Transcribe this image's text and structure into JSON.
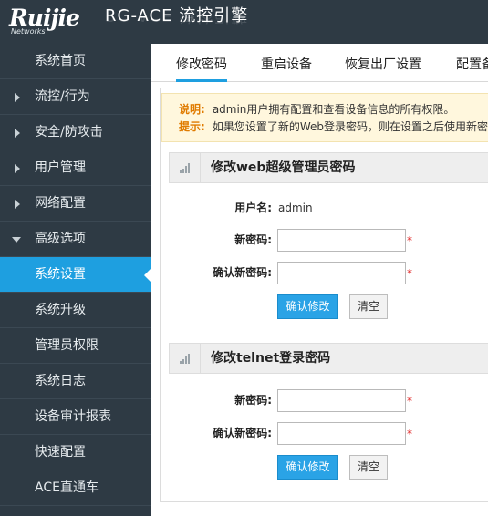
{
  "header": {
    "logo_text": "Ruijie",
    "logo_sub": "Networks",
    "app_title": "RG-ACE 流控引擎"
  },
  "sidebar": {
    "items": [
      {
        "label": "系统首页"
      },
      {
        "label": "流控/行为"
      },
      {
        "label": "安全/防攻击"
      },
      {
        "label": "用户管理"
      },
      {
        "label": "网络配置"
      },
      {
        "label": "高级选项"
      },
      {
        "label": "系统设置"
      },
      {
        "label": "系统升级"
      },
      {
        "label": "管理员权限"
      },
      {
        "label": "系统日志"
      },
      {
        "label": "设备审计报表"
      },
      {
        "label": "快速配置"
      },
      {
        "label": "ACE直通车"
      }
    ]
  },
  "tabs": [
    {
      "label": "修改密码"
    },
    {
      "label": "重启设备"
    },
    {
      "label": "恢复出厂设置"
    },
    {
      "label": "配置备份"
    }
  ],
  "notice": {
    "desc_key": "说明:",
    "desc_text": "admin用户拥有配置和查看设备信息的所有权限。",
    "tip_key": "提示:",
    "tip_text": "如果您设置了新的Web登录密码，则在设置之后使用新密码重新登录"
  },
  "web_section": {
    "title": "修改web超级管理员密码",
    "username_label": "用户名:",
    "username_value": "admin",
    "new_password_label": "新密码:",
    "confirm_password_label": "确认新密码:",
    "confirm_button": "确认修改",
    "clear_button": "清空"
  },
  "telnet_section": {
    "title": "修改telnet登录密码",
    "new_password_label": "新密码:",
    "confirm_password_label": "确认新密码:",
    "confirm_button": "确认修改",
    "clear_button": "清空"
  },
  "required_mark": "*",
  "colors": {
    "sidebar_bg": "#2e3a44",
    "accent": "#1e9fe0",
    "notice_bg": "#fff7dd",
    "notice_key": "#e07b00",
    "required": "#e02020"
  },
  "icons": {
    "collapsed": "triangle-right-icon",
    "expanded": "triangle-down-icon",
    "section": "signal-bars-icon"
  }
}
